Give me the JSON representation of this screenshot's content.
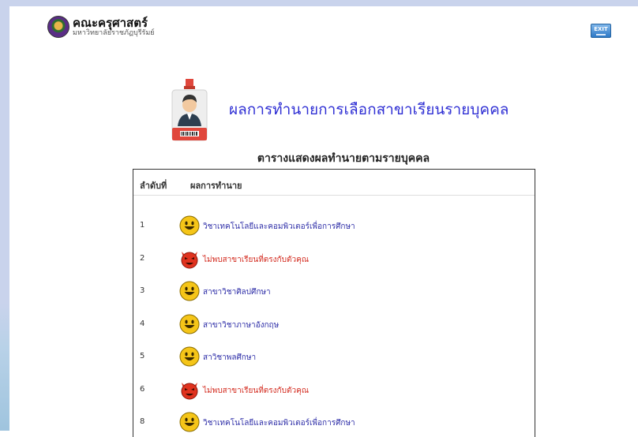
{
  "header": {
    "logo_title": "คณะครุศาสตร์",
    "logo_subtitle": "มหาวิทยาลัยราชภัฏบุรีรัมย์",
    "exit_label": "EXIT"
  },
  "main": {
    "title": "ผลการทำนายการเลือกสาขาเรียนรายบุคคล",
    "subtitle": "ตารางแสดงผลทำนายตามรายบุคคล"
  },
  "table": {
    "headers": {
      "order": "ลำดับที่",
      "result": "ผลการทำนาย"
    },
    "rows": [
      {
        "num": "1",
        "icon": "smile-face-icon",
        "text": "วิชาเทคโนโลยีและคอมพิวเตอร์เพื่อการศึกษา",
        "status": "match"
      },
      {
        "num": "2",
        "icon": "devil-face-icon",
        "text": "ไม่พบสาขาเรียนที่ตรงกับตัวคุณ",
        "status": "nomatch"
      },
      {
        "num": "3",
        "icon": "smile-face-icon",
        "text": "สาขาวิชาศิลปศึกษา",
        "status": "match"
      },
      {
        "num": "4",
        "icon": "smile-face-icon",
        "text": "สาขาวิชาภาษาอังกฤษ",
        "status": "match"
      },
      {
        "num": "5",
        "icon": "smile-face-icon",
        "text": "สาวิชาพลศึกษา",
        "status": "match"
      },
      {
        "num": "6",
        "icon": "devil-face-icon",
        "text": "ไม่พบสาขาเรียนที่ตรงกับตัวคุณ",
        "status": "nomatch"
      },
      {
        "num": "8",
        "icon": "smile-face-icon",
        "text": "วิชาเทคโนโลยีและคอมพิวเตอร์เพื่อการศึกษา",
        "status": "match"
      }
    ]
  },
  "colors": {
    "title": "#2f2fd4",
    "match_text": "#2f2fa8",
    "nomatch_text": "#d32a1e",
    "smile_face": "#f5c518",
    "devil_face": "#e0321e"
  }
}
